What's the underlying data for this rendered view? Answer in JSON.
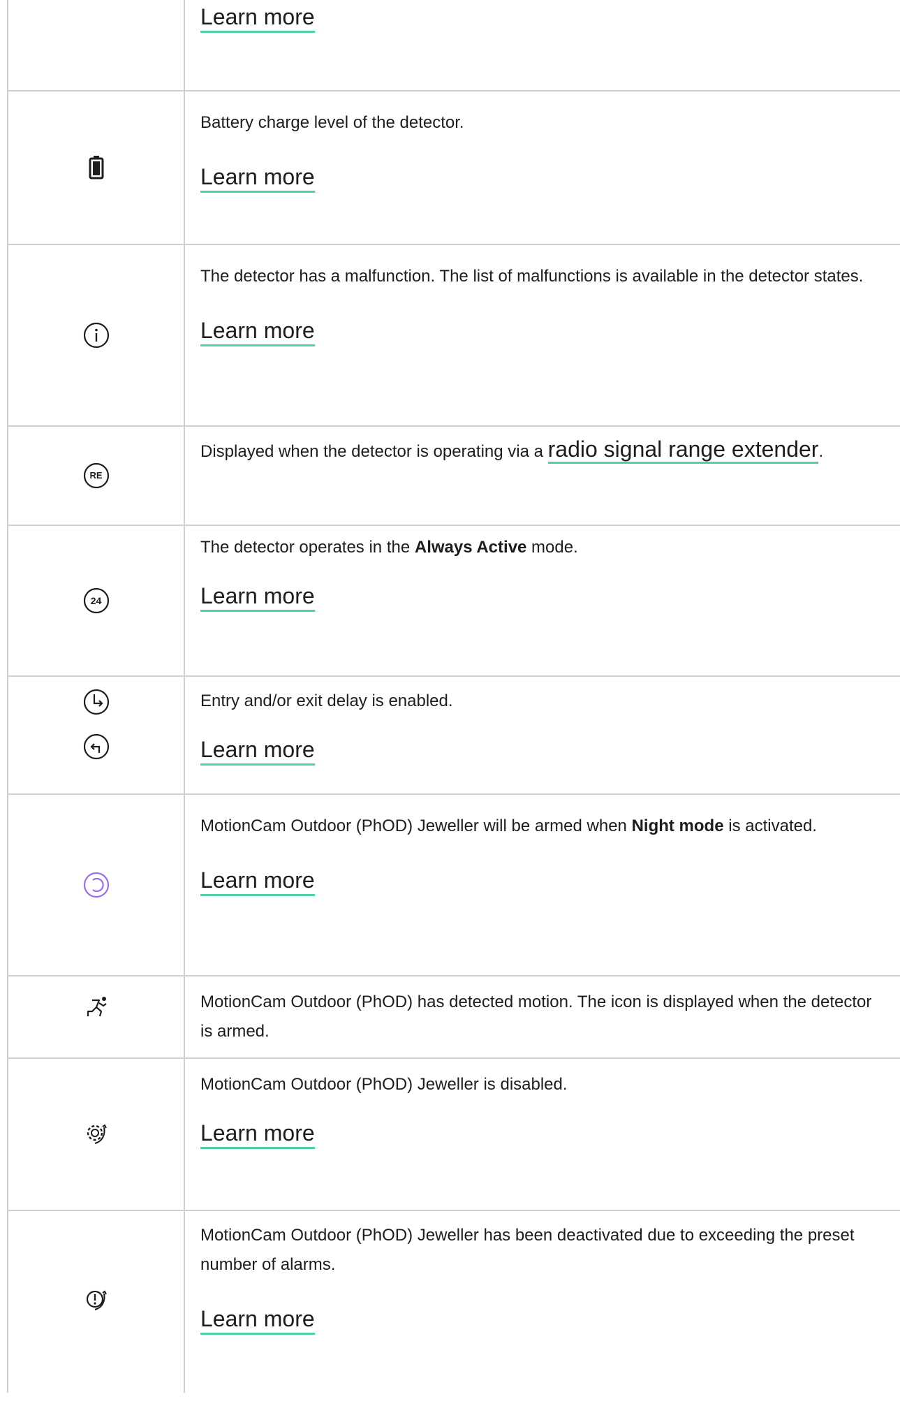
{
  "learn_more": "Learn more",
  "accent": "#4fd1a5",
  "rows": [
    {
      "icon": "none",
      "text": "",
      "link": "Learn more"
    },
    {
      "icon": "battery-icon",
      "text": "Battery charge level of the detector.",
      "link": "Learn more"
    },
    {
      "icon": "info-icon",
      "text": "The detector has a malfunction. The list of malfunctions is available in the detector states.",
      "link": "Learn more"
    },
    {
      "icon": "range-extender-icon",
      "text_before": "Displayed when the detector is operating via a ",
      "link_text": "radio signal range extender",
      "text_after": ".",
      "icon_label": "RE"
    },
    {
      "icon": "always-active-icon",
      "text_before": "The detector operates in the ",
      "bold": "Always Active",
      "text_after": " mode.",
      "link": "Learn more",
      "icon_label": "24"
    },
    {
      "icon": "delay-icons",
      "text": "Entry and/or exit delay is enabled.",
      "link": "Learn more"
    },
    {
      "icon": "night-mode-icon",
      "text_before": "MotionCam Outdoor (PhOD) Jeweller will be armed when ",
      "bold": "Night mode",
      "text_after": " is activated.",
      "link": "Learn more",
      "icon_color": "#9a6cf0"
    },
    {
      "icon": "motion-detected-icon",
      "text": "MotionCam Outdoor (PhOD) has detected motion. The icon is displayed when the detector is armed."
    },
    {
      "icon": "disabled-icon",
      "text": "MotionCam Outdoor (PhOD) Jeweller is disabled.",
      "link": "Learn more"
    },
    {
      "icon": "deactivated-alarms-icon",
      "text": "MotionCam Outdoor (PhOD) Jeweller has been deactivated due to exceeding the preset number of alarms.",
      "link": "Learn more"
    }
  ]
}
